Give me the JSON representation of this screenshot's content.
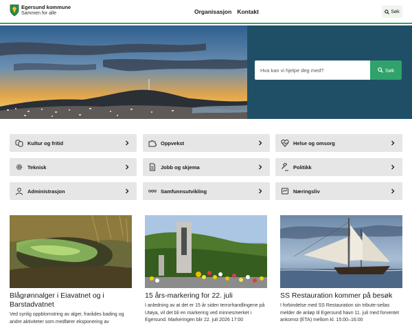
{
  "header": {
    "logo_name": "Egersund kommune",
    "logo_tagline": "Sammen for alle",
    "nav": [
      "Organisasjon",
      "Kontakt"
    ],
    "search_label": "Søk"
  },
  "hero": {
    "search_placeholder": "Hva kan vi hjelpe deg med?",
    "search_button": "Søk"
  },
  "tiles": [
    {
      "label": "Kultur og fritid",
      "icon": "drama-masks-icon"
    },
    {
      "label": "Oppvekst",
      "icon": "puzzle-icon"
    },
    {
      "label": "Helse og omsorg",
      "icon": "heartbeat-icon"
    },
    {
      "label": "Teknisk",
      "icon": "gear-icon"
    },
    {
      "label": "Jobb og skjema",
      "icon": "document-icon"
    },
    {
      "label": "Politikk",
      "icon": "gavel-icon"
    },
    {
      "label": "Administrasjon",
      "icon": "person-icon"
    },
    {
      "label": "Samfunnsutvikling",
      "icon": "dots-icon"
    },
    {
      "label": "Næringsliv",
      "icon": "handshake-icon"
    }
  ],
  "news": [
    {
      "title": "Blågrønnalger i Eiavatnet og i Barstadvatnet",
      "text": "Ved synlig oppblomstring av alger, frarådes bading og andre aktiviteter som medfører eksponering av"
    },
    {
      "title": "15 års-markering for 22. juli",
      "text": "I anledning av at det er 15 år siden terrorhandlingene på Utøya, vil det bli en markering ved minnesmerket i Egersund. Markeringen blir 22. juli 2026 17:00"
    },
    {
      "title": "SS Restauration kommer på besøk",
      "text": "I forbindelse med SS Restauration sin tribute-seilas melder de anløp til Egersund havn 11. juli med forventet ankomst (ETA) mellom kl. 15:00–16:00"
    }
  ],
  "colors": {
    "accent_green": "#2fa36b",
    "hero_panel": "#1f4f66",
    "tile_bg": "#e6e6e6"
  }
}
